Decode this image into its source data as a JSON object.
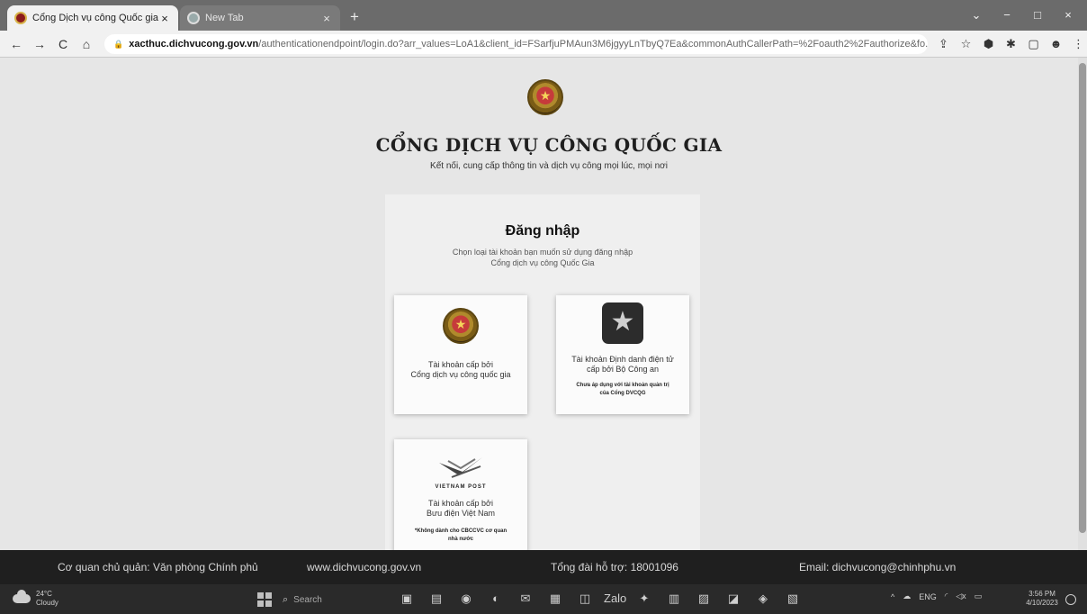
{
  "browser": {
    "tabs": [
      {
        "title": "Cổng Dịch vụ công Quốc gia",
        "close": "×"
      },
      {
        "title": "New Tab",
        "close": "×"
      }
    ],
    "new_tab": "+",
    "window_controls": [
      "⌄",
      "−",
      "□",
      "×"
    ],
    "nav": {
      "back": "←",
      "forward": "→",
      "reload": "C",
      "home": "⌂"
    },
    "url_host": "xacthuc.dichvucong.gov.vn",
    "url_path": "/authenticationendpoint/login.do?arr_values=LoA1&client_id=FSarfjuPMAun3M6jgyyLnTbyQ7Ea&commonAuthCallerPath=%2Foauth2%2Fauthorize&fo...",
    "lock": "🔒",
    "toolbar_icons": [
      "⇪",
      "☆",
      "⬢",
      "✱",
      "▢",
      "☻",
      "⋮"
    ]
  },
  "page": {
    "site_title": "CỔNG DỊCH VỤ CÔNG QUỐC GIA",
    "site_subtitle": "Kết nối, cung cấp thông tin và dịch vụ công mọi lúc, mọi nơi",
    "login": {
      "heading": "Đăng nhập",
      "description_line1": "Chọn loại tài khoản bạn muốn sử dụng đăng nhập",
      "description_line2": "Cổng dịch vụ công Quốc Gia",
      "options": [
        {
          "label_line1": "Tài khoản cấp bởi",
          "label_line2": "Cổng dịch vụ công quốc gia"
        },
        {
          "label_line1": "Tài khoản Định danh điện tử",
          "label_line2": "cấp bởi Bộ Công an",
          "note_line1": "Chưa áp dụng với tài khoản quản trị",
          "note_line2": "của Cổng DVCQG"
        },
        {
          "brand": "VIETNAM POST",
          "label_line1": "Tài khoản cấp bởi",
          "label_line2": "Bưu điện Việt Nam",
          "note_line1": "*Không dành cho CBCCVC cơ quan",
          "note_line2": "nhà nước"
        }
      ]
    }
  },
  "footer": {
    "agency": "Cơ quan chủ quản: Văn phòng Chính phủ",
    "website": "www.dichvucong.gov.vn",
    "hotline": "Tổng đài hỗ trợ: 18001096",
    "email": "Email: dichvucong@chinhphu.vn"
  },
  "taskbar": {
    "weather_temp": "24°C",
    "weather_desc": "Cloudy",
    "search_placeholder": "Search",
    "task_icons": [
      "▣",
      "▤",
      "◉",
      "◐",
      "✉",
      "▦",
      "◫",
      "Zalo",
      "✦",
      "▥",
      "▨",
      "◪",
      "◈",
      "▧"
    ],
    "tray": [
      "^",
      "☁",
      "ENG",
      "◜",
      "◁x",
      "▭"
    ],
    "time": "3:56 PM",
    "date": "4/10/2023"
  },
  "colors": {
    "footer_bg": "#1f1f1f",
    "taskbar_bg": "#2a2a2a",
    "page_bg": "#e6e6e6",
    "card_bg": "#efefef"
  }
}
